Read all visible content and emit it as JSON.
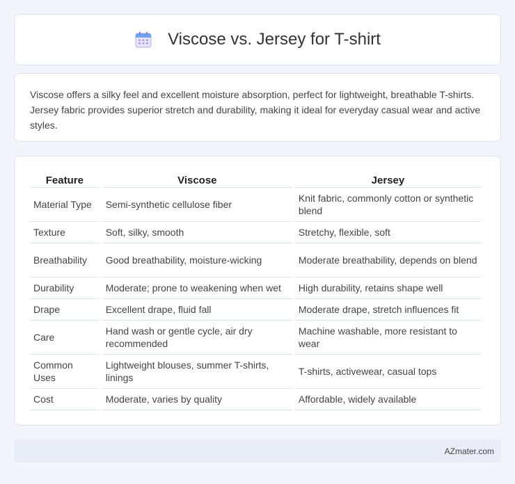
{
  "header": {
    "title": "Viscose vs. Jersey for T-shirt",
    "icon": "calendar-icon"
  },
  "summary": {
    "text": "Viscose offers a silky feel and excellent moisture absorption, perfect for lightweight, breathable T-shirts. Jersey fabric provides superior stretch and durability, making it ideal for everyday casual wear and active styles."
  },
  "table": {
    "headers": [
      "Feature",
      "Viscose",
      "Jersey"
    ],
    "rows": [
      [
        "Material Type",
        "Semi-synthetic cellulose fiber",
        "Knit fabric, commonly cotton or synthetic blend"
      ],
      [
        "Texture",
        "Soft, silky, smooth",
        "Stretchy, flexible, soft"
      ],
      [
        "Breathability",
        "Good breathability, moisture-wicking",
        "Moderate breathability, depends on blend"
      ],
      [
        "Durability",
        "Moderate; prone to weakening when wet",
        "High durability, retains shape well"
      ],
      [
        "Drape",
        "Excellent drape, fluid fall",
        "Moderate drape, stretch influences fit"
      ],
      [
        "Care",
        "Hand wash or gentle cycle, air dry recommended",
        "Machine washable, more resistant to wear"
      ],
      [
        "Common Uses",
        "Lightweight blouses, summer T-shirts, linings",
        "T-shirts, activewear, casual tops"
      ],
      [
        "Cost",
        "Moderate, varies by quality",
        "Affordable, widely available"
      ]
    ]
  },
  "footer": {
    "text": "AZmater.com"
  }
}
